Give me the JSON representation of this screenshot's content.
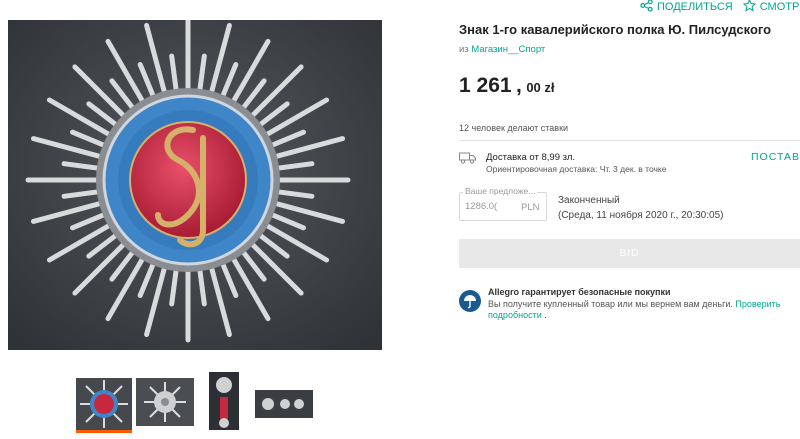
{
  "header": {
    "share_label": "ПОДЕЛИТЬСЯ",
    "watch_label": "СМОТРЕ"
  },
  "listing": {
    "title": "Знак 1-го кавалерийского полка Ю. Пилсудского",
    "seller_prefix": "из",
    "seller_name": "Магазин__Спорт",
    "price_main": "1 261",
    "price_sep": ",",
    "price_cents": "00 zł",
    "bidders_text": "12 человек делают ставки"
  },
  "shipping": {
    "title": "Доставка от 8,99 зл.",
    "subtitle": "Ориентировочная доставка: Чт. 3 дек. в точке",
    "link_label": "ПОСТАВ"
  },
  "bid": {
    "field_label": "Ваше предложе...",
    "field_value": "1286.0(",
    "currency": "PLN",
    "status": "Законченный",
    "end_date": "(Среда, 11 ноября 2020 г., 20:30:05)",
    "button_label": "BID"
  },
  "protection": {
    "title": "Allegro гарантирует безопасные покупки",
    "text_line1": "Вы получите купленный товар или мы вернем вам деньги.",
    "link_part1": "Проверить",
    "link_part2": "подробности",
    "text_end": "."
  },
  "gallery": {
    "main_image_icon": "badge-photo",
    "thumbnails": [
      "front-photo",
      "back-photo",
      "side-photo",
      "screws-photo"
    ],
    "active_index": 0
  },
  "colors": {
    "accent": "#00a790",
    "active_thumb": "#ff5a00",
    "protection_badge": "#1a5a8e",
    "badge_red": "#c8283f",
    "badge_blue": "#3f86c9"
  }
}
